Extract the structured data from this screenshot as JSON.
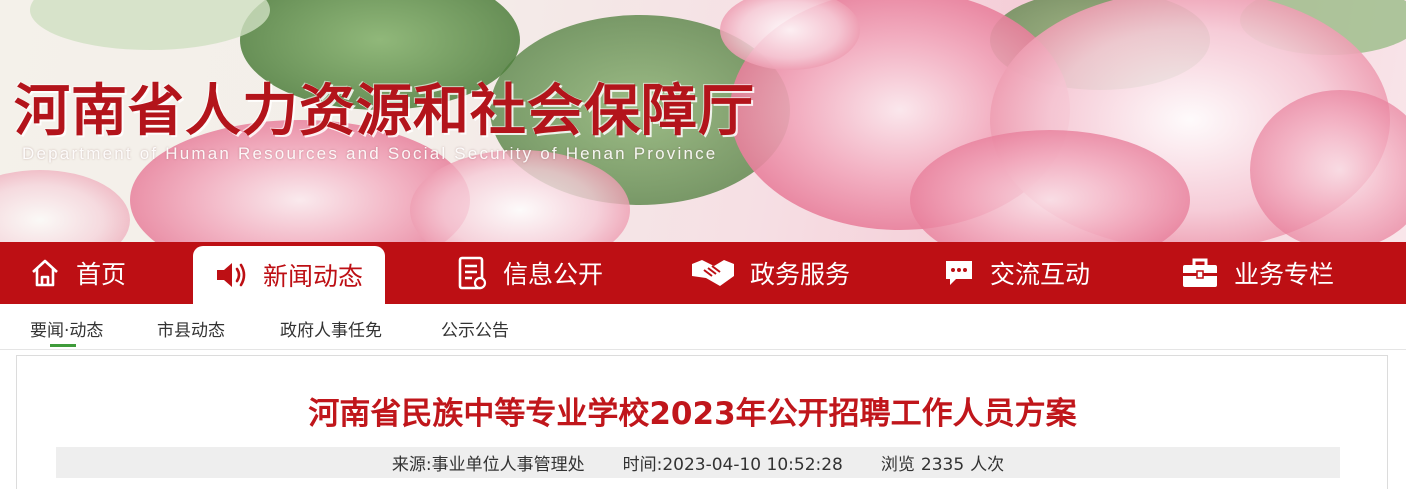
{
  "site": {
    "title": "河南省人力资源和社会保障厅",
    "subtitle": "Department of Human Resources and Social Security of Henan Province"
  },
  "nav": {
    "items": [
      {
        "label": "首页",
        "icon": "home-icon"
      },
      {
        "label": "新闻动态",
        "icon": "speaker-icon",
        "active": true
      },
      {
        "label": "信息公开",
        "icon": "document-icon"
      },
      {
        "label": "政务服务",
        "icon": "handshake-icon"
      },
      {
        "label": "交流互动",
        "icon": "chat-icon"
      },
      {
        "label": "业务专栏",
        "icon": "briefcase-icon"
      }
    ]
  },
  "subnav": {
    "items": [
      "要闻·动态",
      "市县动态",
      "政府人事任免",
      "公示公告"
    ]
  },
  "article": {
    "title": "河南省民族中等专业学校2023年公开招聘工作人员方案",
    "source_label": "来源:",
    "source": "事业单位人事管理处",
    "time_label": "时间:",
    "time": "2023-04-10 10:52:28",
    "views_label": "浏览",
    "views": "2335",
    "views_unit": "人次"
  },
  "colors": {
    "brand_red": "#bd0f14",
    "title_red": "#c0161b",
    "active_marker_green": "#3f9b3a"
  }
}
